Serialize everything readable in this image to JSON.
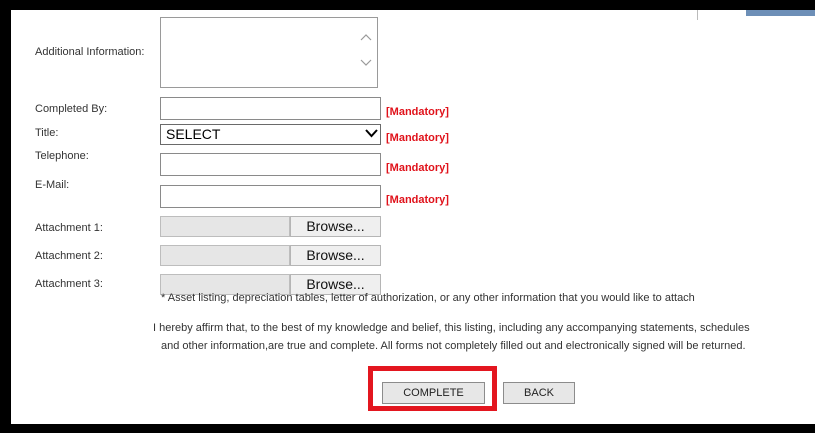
{
  "form": {
    "fields": [
      {
        "label": "Additional Information:",
        "type": "textarea",
        "value": ""
      },
      {
        "label": "Completed By:",
        "type": "text",
        "value": "",
        "mandatory": "[Mandatory]"
      },
      {
        "label": "Title:",
        "type": "select",
        "selected": "SELECT",
        "mandatory": "[Mandatory]"
      },
      {
        "label": "Telephone:",
        "type": "text",
        "value": "",
        "mandatory": "[Mandatory]"
      },
      {
        "label": "E-Mail:",
        "type": "text",
        "value": "",
        "mandatory": "[Mandatory]"
      }
    ],
    "attachments": [
      {
        "label": "Attachment 1:",
        "button": "Browse..."
      },
      {
        "label": "Attachment 2:",
        "button": "Browse..."
      },
      {
        "label": "Attachment 3:",
        "button": "Browse..."
      }
    ],
    "attachment_note": "* Asset listing, depreciation tables, letter of authorization, or any other information that you would like to attach",
    "affirmation_line1": "I hereby affirm that, to the best of my knowledge and belief, this listing, including any accompanying statements, schedules",
    "affirmation_line2": "and other information,are true and complete. All forms not completely filled out and electronically signed will be returned.",
    "buttons": {
      "complete": "COMPLETE",
      "back": "BACK"
    }
  },
  "colors": {
    "mandatory": "#e0121b",
    "highlight": "#e3161f"
  }
}
